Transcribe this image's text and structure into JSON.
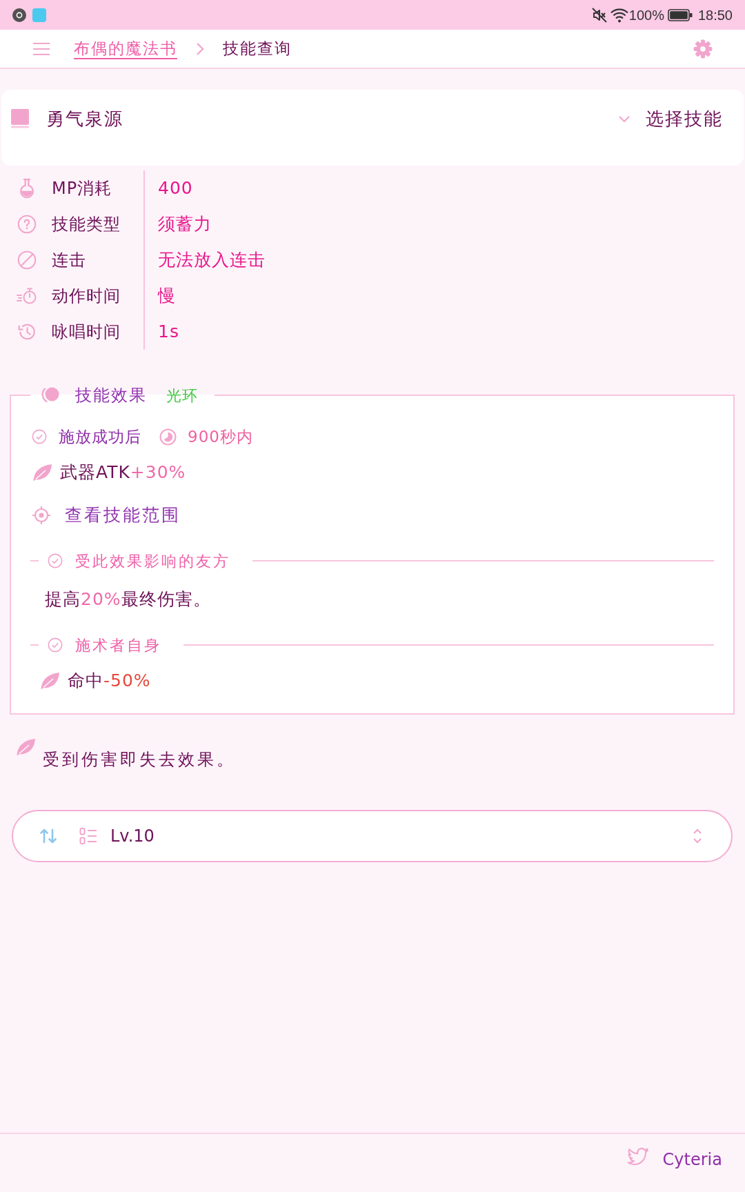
{
  "status_bar": {
    "battery": "100%",
    "time": "18:50"
  },
  "nav": {
    "breadcrumb": [
      {
        "label": "布偶的魔法书",
        "kind": "link"
      },
      {
        "label": "技能查询",
        "kind": "current"
      }
    ]
  },
  "skill_picker": {
    "skill": "勇气泉源",
    "button": "选择技能"
  },
  "properties": [
    {
      "label": "MP消耗",
      "value": "400"
    },
    {
      "label": "技能类型",
      "value": "须蓄力"
    },
    {
      "label": "连击",
      "value": "无法放入连击"
    },
    {
      "label": "动作时间",
      "value": "慢"
    },
    {
      "label": "咏唱时间",
      "value": "1s"
    }
  ],
  "effect": {
    "title": "技能效果",
    "tag": "光环",
    "trigger": "施放成功后",
    "duration": "900秒内",
    "entries": [
      {
        "kind": "stat",
        "name": "武器ATK",
        "change": "+30%",
        "color": "#f06aa8"
      },
      {
        "kind": "button",
        "label": "查看技能范围"
      },
      {
        "kind": "group",
        "title": "受此效果影响的友方",
        "entries": [
          {
            "kind": "text",
            "parts": [
              {
                "text": "提高",
                "highlight": false
              },
              {
                "text": "20%",
                "highlight": true
              },
              {
                "text": "最终伤害。",
                "highlight": false
              }
            ]
          }
        ]
      },
      {
        "kind": "group",
        "title": "施术者自身",
        "entries": [
          {
            "kind": "stat",
            "name": "命中",
            "change": "-50%",
            "color": "#e64a3c"
          }
        ]
      }
    ]
  },
  "note": "受到伤害即失去效果。",
  "level_select": {
    "value": "Lv.10"
  },
  "footer": {
    "author": "Cyteria"
  }
}
